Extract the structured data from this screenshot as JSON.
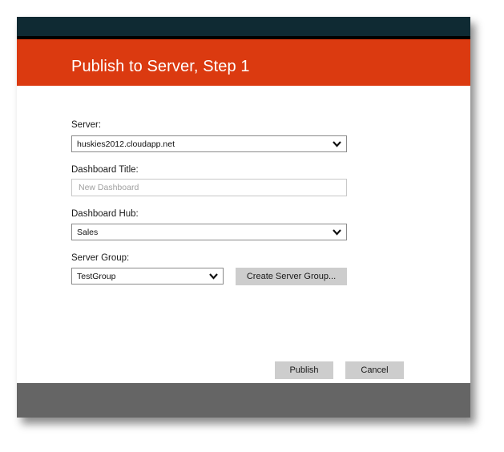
{
  "dialog": {
    "title": "Publish to Server, Step 1"
  },
  "form": {
    "server": {
      "label": "Server:",
      "value": "huskies2012.cloudapp.net"
    },
    "dashboard_title": {
      "label": "Dashboard Title:",
      "placeholder": "New Dashboard",
      "value": ""
    },
    "dashboard_hub": {
      "label": "Dashboard Hub:",
      "value": "Sales"
    },
    "server_group": {
      "label": "Server Group:",
      "value": "TestGroup",
      "create_button": "Create Server Group..."
    }
  },
  "actions": {
    "publish": "Publish",
    "cancel": "Cancel"
  },
  "colors": {
    "topbar": "#0f2a33",
    "header": "#db3a10",
    "footer": "#656565",
    "button": "#cdcdcd"
  },
  "icons": {
    "dropdown": "chevron-down-icon"
  }
}
